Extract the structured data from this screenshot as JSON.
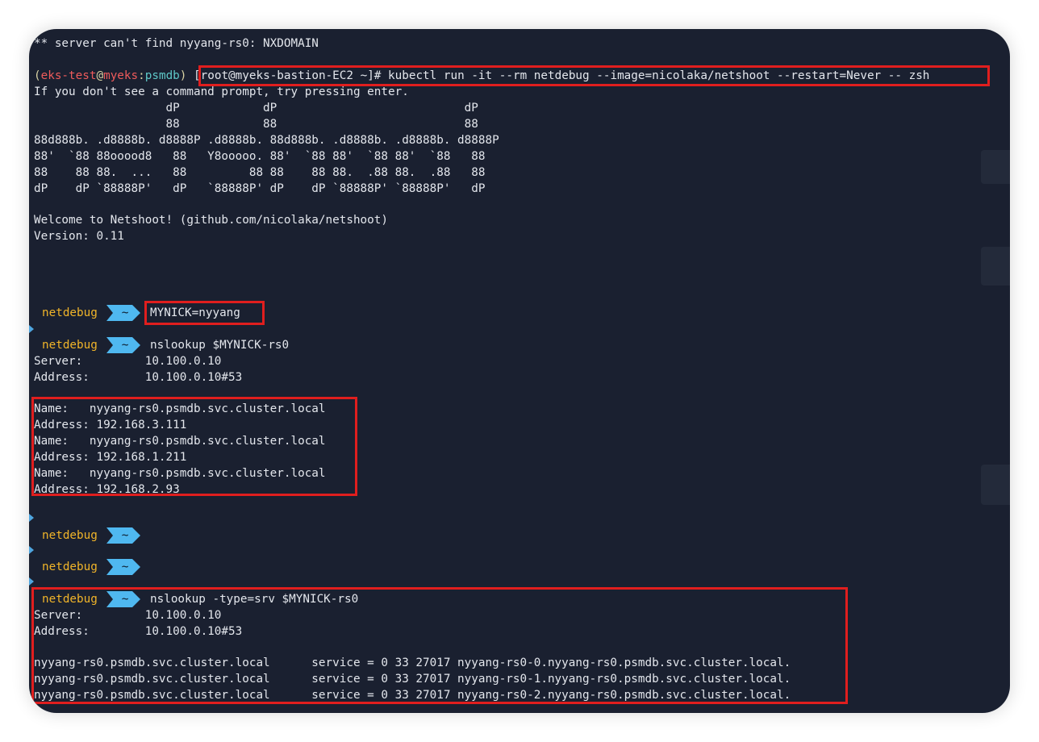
{
  "terminal": {
    "lines": [
      "** server can't find nyyang-rs0: NXDOMAIN",
      "If you don't see a command prompt, try pressing enter.",
      "                   dP            dP                           dP",
      "                   88            88                           88",
      "88d888b. .d8888b. d8888P .d8888b. 88d888b. .d8888b. .d8888b. d8888P",
      "88'  `88 88ooood8   88   Y8ooooo. 88'  `88 88'  `88 88'  `88   88",
      "88    88 88.  ...   88         88 88    88 88.  .88 88.  .88   88",
      "dP    dP `88888P'   dP   `88888P' dP    dP `88888P' `88888P'   dP",
      "Welcome to Netshoot! (github.com/nicolaka/netshoot)",
      "Version: 0.11"
    ],
    "shell_prompt": {
      "open_paren": "(",
      "user": "eks-test",
      "at": "@",
      "host": "myeks",
      "colon": ":",
      "namespace": "psmdb",
      "close_paren": ")",
      "command": "[root@myeks-bastion-EC2 ~]# kubectl run -it --rm netdebug --image=nicolaka/netshoot --restart=Never -- zsh"
    },
    "prompt_name": "netdebug",
    "prompt_dir": "~",
    "cmd_set": "MYNICK=nyyang",
    "cmd_nslookup": "nslookup $MYNICK-rs0",
    "cmd_srv": "nslookup -type=srv $MYNICK-rs0",
    "server_line": "Server:         10.100.0.10",
    "address_line": "Address:        10.100.0.10#53",
    "a_records": [
      "Name:   nyyang-rs0.psmdb.svc.cluster.local",
      "Address: 192.168.3.111",
      "Name:   nyyang-rs0.psmdb.svc.cluster.local",
      "Address: 192.168.1.211",
      "Name:   nyyang-rs0.psmdb.svc.cluster.local",
      "Address: 192.168.2.93"
    ],
    "srv_records": [
      "nyyang-rs0.psmdb.svc.cluster.local      service = 0 33 27017 nyyang-rs0-0.nyyang-rs0.psmdb.svc.cluster.local.",
      "nyyang-rs0.psmdb.svc.cluster.local      service = 0 33 27017 nyyang-rs0-1.nyyang-rs0.psmdb.svc.cluster.local.",
      "nyyang-rs0.psmdb.svc.cluster.local      service = 0 33 27017 nyyang-rs0-2.nyyang-rs0.psmdb.svc.cluster.local."
    ]
  },
  "colors": {
    "background": "#1a2030",
    "text": "#e3e6ec",
    "prompt_name": "#f0b429",
    "prompt_segment": "#4fb8f0",
    "highlight_box": "#e01e1e"
  }
}
